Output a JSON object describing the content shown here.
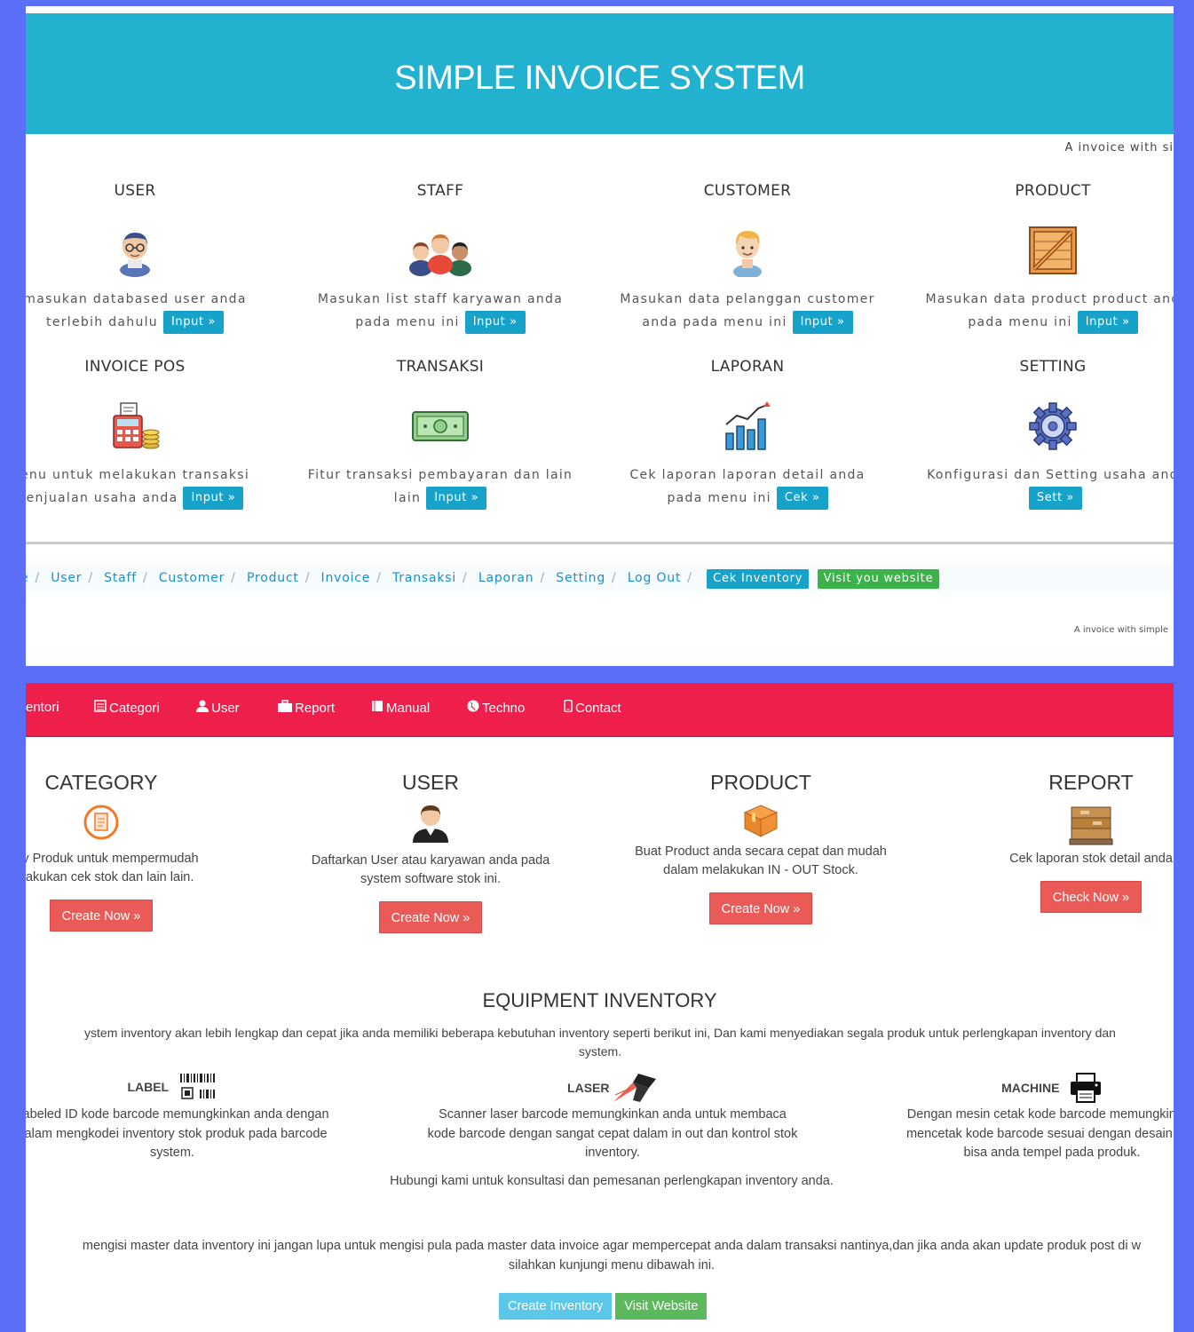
{
  "top": {
    "title": "SIMPLE INVOICE SYSTEM",
    "tagline": "A invoice with si",
    "features": [
      {
        "title": "USER",
        "desc1": "masukan databased user anda",
        "desc2": "terlebih dahulu",
        "btn": "Input »",
        "icon": "user-icon"
      },
      {
        "title": "STAFF",
        "desc1": "Masukan list staff karyawan anda",
        "desc2": "pada menu ini",
        "btn": "Input »",
        "icon": "staff-group-icon"
      },
      {
        "title": "CUSTOMER",
        "desc1": "Masukan data pelanggan customer",
        "desc2": "anda pada menu ini",
        "btn": "Input »",
        "icon": "customer-icon"
      },
      {
        "title": "PRODUCT",
        "desc1": "Masukan data product product and",
        "desc2": "pada menu ini",
        "btn": "Input »",
        "icon": "crate-icon"
      },
      {
        "title": "INVOICE POS",
        "desc1": "enu untuk melakukan transaksi",
        "desc2": "enjualan usaha anda",
        "btn": "Input »",
        "icon": "pos-register-icon"
      },
      {
        "title": "TRANSAKSI",
        "desc1": "Fitur transaksi pembayaran dan lain",
        "desc2": "lain",
        "btn": "Input »",
        "icon": "cash-icon"
      },
      {
        "title": "LAPORAN",
        "desc1": "Cek laporan laporan detail anda",
        "desc2": "pada menu ini",
        "btn": "Cek »",
        "icon": "chart-icon"
      },
      {
        "title": "SETTING",
        "desc1": "Konfigurasi dan Setting usaha and",
        "desc2": "",
        "btn": "Sett »",
        "icon": "gear-icon"
      }
    ],
    "breadcrumb": [
      "e",
      "User",
      "Staff",
      "Customer",
      "Product",
      "Invoice",
      "Transaksi",
      "Laporan",
      "Setting",
      "Log Out"
    ],
    "badge_inventory": "Cek Inventory",
    "badge_website": "Visit you website",
    "footer": "A invoice with simple"
  },
  "bottom": {
    "nav": [
      {
        "label": "entori",
        "icon": ""
      },
      {
        "label": "Categori",
        "icon": "list-icon"
      },
      {
        "label": "User",
        "icon": "user-icon"
      },
      {
        "label": "Report",
        "icon": "briefcase-icon"
      },
      {
        "label": "Manual",
        "icon": "book-icon"
      },
      {
        "label": "Techno",
        "icon": "globe-icon"
      },
      {
        "label": "Contact",
        "icon": "phone-icon"
      }
    ],
    "cards": [
      {
        "title": "CATEGORY",
        "desc1": "gory Produk untuk mempermudah",
        "desc2": "nelakukan cek stok dan lain lain.",
        "btn": "Create Now »"
      },
      {
        "title": "USER",
        "desc1": "Daftarkan User atau karyawan anda pada",
        "desc2": "system software stok ini.",
        "btn": "Create Now »"
      },
      {
        "title": "PRODUCT",
        "desc1": "Buat Product anda secara cepat dan mudah",
        "desc2": "dalam melakukan IN - OUT Stock.",
        "btn": "Create Now »"
      },
      {
        "title": "REPORT",
        "desc1": "Cek laporan stok detail anda",
        "desc2": "",
        "btn": "Check Now »"
      }
    ],
    "equip_title": "EQUIPMENT INVENTORY",
    "equip_desc1": "ystem inventory akan lebih lengkap dan cepat jika anda memiliki beberapa kebutuhan inventory seperti berikut ini, Dan kami menyediakan segala produk untuk perlengkapan inventory dan",
    "equip_desc2": "system.",
    "equipment": [
      {
        "label": "LABEL",
        "desc1": "Labeled ID kode barcode memungkinkan anda dengan",
        "desc2": "dalam mengkodei inventory stok produk pada barcode",
        "desc3": "system."
      },
      {
        "label": "LASER",
        "desc1": "Scanner laser barcode memungkinkan anda untuk membaca",
        "desc2": "kode barcode dengan sangat cepat dalam in out dan kontrol stok",
        "desc3": "inventory."
      },
      {
        "label": "MACHINE",
        "desc1": "Dengan mesin cetak kode barcode memungkinkan",
        "desc2": "mencetak kode barcode sesuai dengan desain and",
        "desc3": "bisa anda tempel pada produk."
      }
    ],
    "contact_note": "Hubungi kami untuk konsultasi dan pemesanan perlengkapan inventory anda.",
    "note1": "mengisi master data inventory ini jangan lupa untuk mengisi pula pada master data invoice agar mempercepat anda dalam transaksi nantinya,dan jika anda akan update produk post di w",
    "note2": "silahkan kunjungi menu dibawah ini.",
    "btn_create_inventory": "Create Inventory",
    "btn_visit_website": "Visit Website"
  },
  "colors": {
    "background": "#5b6ef7",
    "top_header": "#22b2cf",
    "info_button": "#17a2c9",
    "nav_bar": "#ef1f4b",
    "danger_button": "#ea5b58",
    "success": "#5cb85c"
  }
}
